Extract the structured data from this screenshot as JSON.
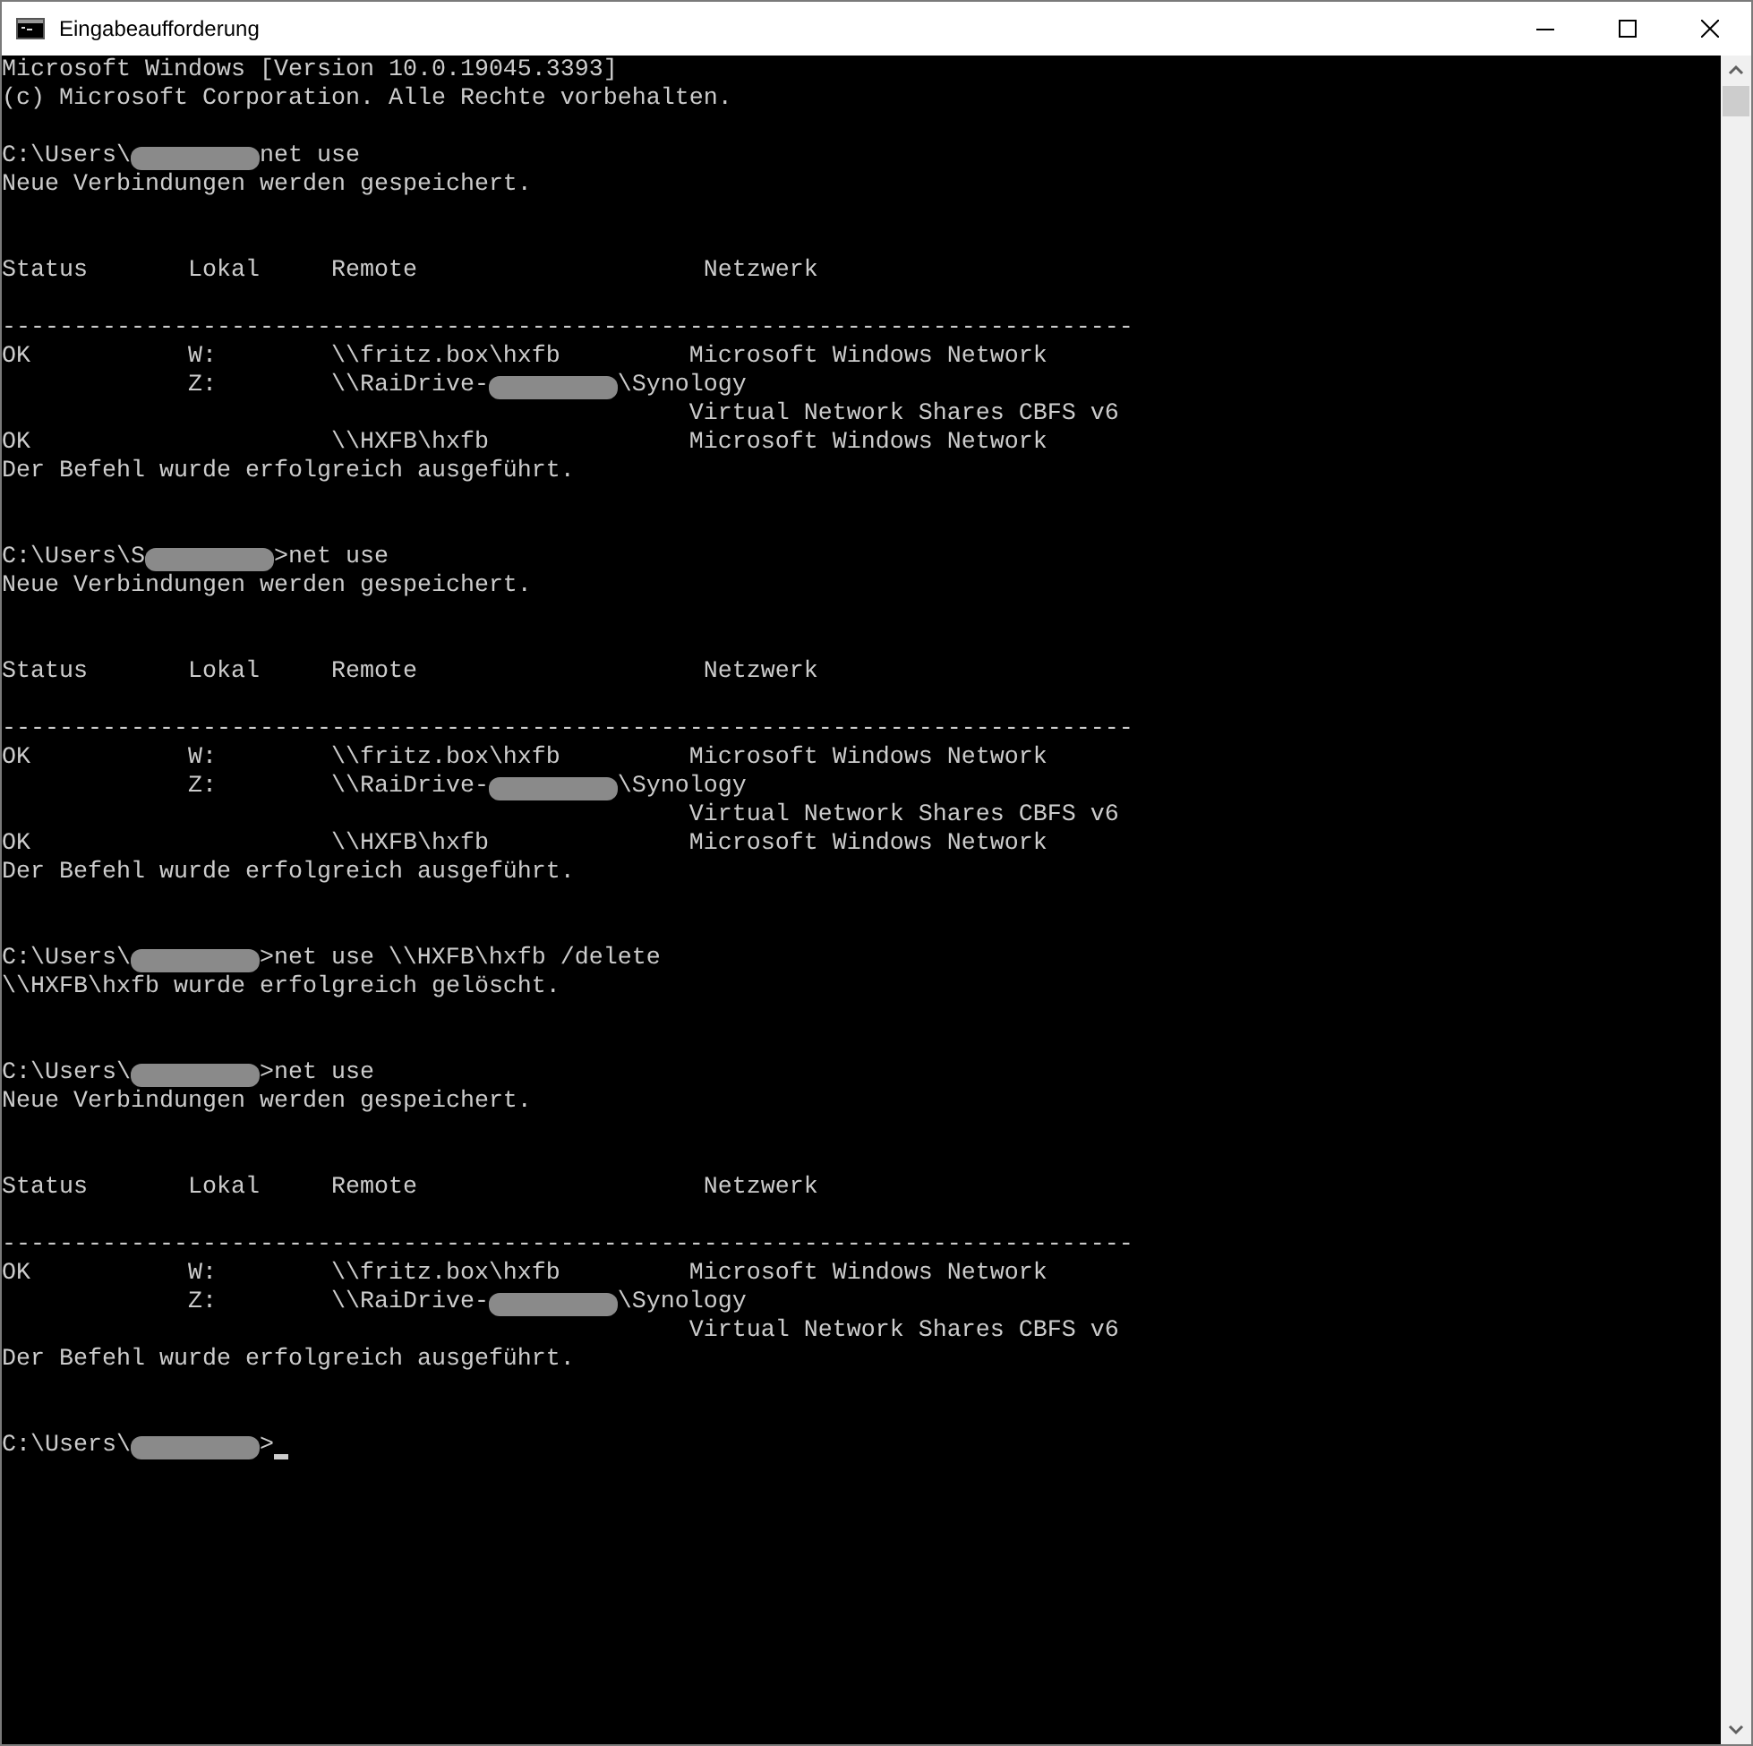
{
  "window": {
    "title": "Eingabeaufforderung"
  },
  "console": {
    "lines": [
      {
        "kind": "text",
        "segments": [
          {
            "kind": "text",
            "text": "Microsoft Windows [Version 10.0.19045.3393]"
          }
        ]
      },
      {
        "kind": "text",
        "segments": [
          {
            "kind": "text",
            "text": "(c) Microsoft Corporation. Alle Rechte vorbehalten."
          }
        ]
      },
      {
        "kind": "blank"
      },
      {
        "kind": "text",
        "segments": [
          {
            "kind": "text",
            "text": "C:\\Users\\"
          },
          {
            "kind": "redaction"
          },
          {
            "kind": "text",
            "text": "net use"
          }
        ]
      },
      {
        "kind": "text",
        "segments": [
          {
            "kind": "text",
            "text": "Neue Verbindungen werden gespeichert."
          }
        ]
      },
      {
        "kind": "blank"
      },
      {
        "kind": "blank"
      },
      {
        "kind": "text",
        "segments": [
          {
            "kind": "text",
            "text": "Status       Lokal     Remote                    Netzwerk"
          }
        ]
      },
      {
        "kind": "blank"
      },
      {
        "kind": "text",
        "segments": [
          {
            "kind": "text",
            "text": "-------------------------------------------------------------------------------"
          }
        ]
      },
      {
        "kind": "text",
        "segments": [
          {
            "kind": "text",
            "text": "OK           W:        \\\\fritz.box\\hxfb         Microsoft Windows Network"
          }
        ]
      },
      {
        "kind": "text",
        "segments": [
          {
            "kind": "text",
            "text": "             Z:        \\\\RaiDrive-"
          },
          {
            "kind": "redaction"
          },
          {
            "kind": "text",
            "text": "\\Synology"
          }
        ]
      },
      {
        "kind": "text",
        "segments": [
          {
            "kind": "text",
            "text": "                                                Virtual Network Shares CBFS v6"
          }
        ]
      },
      {
        "kind": "text",
        "segments": [
          {
            "kind": "text",
            "text": "OK                     \\\\HXFB\\hxfb              Microsoft Windows Network"
          }
        ]
      },
      {
        "kind": "text",
        "segments": [
          {
            "kind": "text",
            "text": "Der Befehl wurde erfolgreich ausgeführt."
          }
        ]
      },
      {
        "kind": "blank"
      },
      {
        "kind": "blank"
      },
      {
        "kind": "text",
        "segments": [
          {
            "kind": "text",
            "text": "C:\\Users\\S"
          },
          {
            "kind": "redaction"
          },
          {
            "kind": "text",
            "text": ">net use"
          }
        ]
      },
      {
        "kind": "text",
        "segments": [
          {
            "kind": "text",
            "text": "Neue Verbindungen werden gespeichert."
          }
        ]
      },
      {
        "kind": "blank"
      },
      {
        "kind": "blank"
      },
      {
        "kind": "text",
        "segments": [
          {
            "kind": "text",
            "text": "Status       Lokal     Remote                    Netzwerk"
          }
        ]
      },
      {
        "kind": "blank"
      },
      {
        "kind": "text",
        "segments": [
          {
            "kind": "text",
            "text": "-------------------------------------------------------------------------------"
          }
        ]
      },
      {
        "kind": "text",
        "segments": [
          {
            "kind": "text",
            "text": "OK           W:        \\\\fritz.box\\hxfb         Microsoft Windows Network"
          }
        ]
      },
      {
        "kind": "text",
        "segments": [
          {
            "kind": "text",
            "text": "             Z:        \\\\RaiDrive-"
          },
          {
            "kind": "redaction"
          },
          {
            "kind": "text",
            "text": "\\Synology"
          }
        ]
      },
      {
        "kind": "text",
        "segments": [
          {
            "kind": "text",
            "text": "                                                Virtual Network Shares CBFS v6"
          }
        ]
      },
      {
        "kind": "text",
        "segments": [
          {
            "kind": "text",
            "text": "OK                     \\\\HXFB\\hxfb              Microsoft Windows Network"
          }
        ]
      },
      {
        "kind": "text",
        "segments": [
          {
            "kind": "text",
            "text": "Der Befehl wurde erfolgreich ausgeführt."
          }
        ]
      },
      {
        "kind": "blank"
      },
      {
        "kind": "blank"
      },
      {
        "kind": "text",
        "segments": [
          {
            "kind": "text",
            "text": "C:\\Users\\"
          },
          {
            "kind": "redaction"
          },
          {
            "kind": "text",
            "text": ">net use \\\\HXFB\\hxfb /delete"
          }
        ]
      },
      {
        "kind": "text",
        "segments": [
          {
            "kind": "text",
            "text": "\\\\HXFB\\hxfb wurde erfolgreich gelöscht."
          }
        ]
      },
      {
        "kind": "blank"
      },
      {
        "kind": "blank"
      },
      {
        "kind": "text",
        "segments": [
          {
            "kind": "text",
            "text": "C:\\Users\\"
          },
          {
            "kind": "redaction"
          },
          {
            "kind": "text",
            "text": ">net use"
          }
        ]
      },
      {
        "kind": "text",
        "segments": [
          {
            "kind": "text",
            "text": "Neue Verbindungen werden gespeichert."
          }
        ]
      },
      {
        "kind": "blank"
      },
      {
        "kind": "blank"
      },
      {
        "kind": "text",
        "segments": [
          {
            "kind": "text",
            "text": "Status       Lokal     Remote                    Netzwerk"
          }
        ]
      },
      {
        "kind": "blank"
      },
      {
        "kind": "text",
        "segments": [
          {
            "kind": "text",
            "text": "-------------------------------------------------------------------------------"
          }
        ]
      },
      {
        "kind": "text",
        "segments": [
          {
            "kind": "text",
            "text": "OK           W:        \\\\fritz.box\\hxfb         Microsoft Windows Network"
          }
        ]
      },
      {
        "kind": "text",
        "segments": [
          {
            "kind": "text",
            "text": "             Z:        \\\\RaiDrive-"
          },
          {
            "kind": "redaction"
          },
          {
            "kind": "text",
            "text": "\\Synology"
          }
        ]
      },
      {
        "kind": "text",
        "segments": [
          {
            "kind": "text",
            "text": "                                                Virtual Network Shares CBFS v6"
          }
        ]
      },
      {
        "kind": "text",
        "segments": [
          {
            "kind": "text",
            "text": "Der Befehl wurde erfolgreich ausgeführt."
          }
        ]
      },
      {
        "kind": "blank"
      },
      {
        "kind": "blank"
      },
      {
        "kind": "text",
        "cursor": true,
        "segments": [
          {
            "kind": "text",
            "text": "C:\\Users\\"
          },
          {
            "kind": "redaction"
          },
          {
            "kind": "text",
            "text": ">"
          }
        ]
      }
    ]
  }
}
